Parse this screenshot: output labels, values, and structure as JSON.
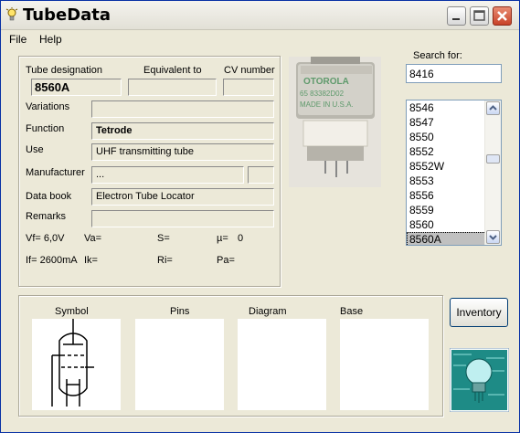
{
  "window": {
    "title": "TubeData"
  },
  "menu": {
    "file": "File",
    "help": "Help"
  },
  "form": {
    "tube_designation_label": "Tube designation",
    "tube_designation": "8560A",
    "equivalent_label": "Equivalent to",
    "equivalent": "",
    "cv_label": "CV number",
    "cv": "",
    "variations_label": "Variations",
    "variations": "",
    "function_label": "Function",
    "function": "Tetrode",
    "use_label": "Use",
    "use": "UHF transmitting tube",
    "manufacturer_label": "Manufacturer",
    "manufacturer": "...",
    "manufacturer_extra": "",
    "databook_label": "Data book",
    "databook": "Electron Tube Locator",
    "remarks_label": "Remarks",
    "remarks": ""
  },
  "params": {
    "vf": "Vf= 6,0V",
    "va": "Va=",
    "s": "S=",
    "mu": "µ=",
    "mu_value": "0",
    "if": "If= 2600mA",
    "ik": "Ik=",
    "ri": "Ri=",
    "pa": "Pa="
  },
  "search": {
    "label": "Search for:",
    "value": "8416",
    "items": [
      "8546",
      "8547",
      "8550",
      "8552",
      "8552W",
      "8553",
      "8556",
      "8559",
      "8560",
      "8560A"
    ],
    "selected_index": 9
  },
  "bottom": {
    "symbol_label": "Symbol",
    "pins_label": "Pins",
    "diagram_label": "Diagram",
    "base_label": "Base"
  },
  "buttons": {
    "inventory": "Inventory"
  },
  "photo": {
    "text_line1": "OTOROLA",
    "text_line2": "65 83382D02",
    "text_line3": "MADE IN U.S.A."
  }
}
